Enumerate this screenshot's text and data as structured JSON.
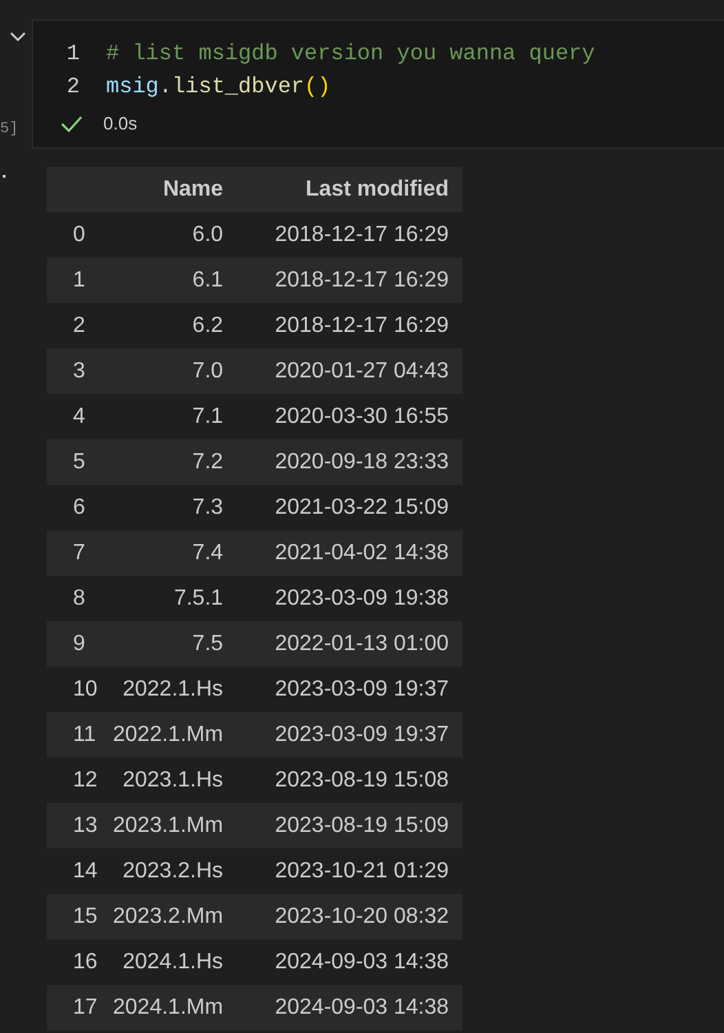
{
  "cell": {
    "execution_count": "5]",
    "collapsed": false,
    "lines": [
      {
        "number": "1",
        "tokens": [
          {
            "kind": "comment",
            "text": "# list msigdb version you wanna query"
          }
        ]
      },
      {
        "number": "2",
        "tokens": [
          {
            "kind": "variable",
            "text": "msig"
          },
          {
            "kind": "plain",
            "text": "."
          },
          {
            "kind": "function",
            "text": "list_dbver"
          },
          {
            "kind": "bracket",
            "text": "()"
          }
        ]
      }
    ],
    "status": {
      "success": true,
      "duration": "0.0s"
    }
  },
  "table": {
    "columns": [
      "",
      "Name",
      "Last modified"
    ],
    "rows": [
      [
        "0",
        "6.0",
        "2018-12-17 16:29"
      ],
      [
        "1",
        "6.1",
        "2018-12-17 16:29"
      ],
      [
        "2",
        "6.2",
        "2018-12-17 16:29"
      ],
      [
        "3",
        "7.0",
        "2020-01-27 04:43"
      ],
      [
        "4",
        "7.1",
        "2020-03-30 16:55"
      ],
      [
        "5",
        "7.2",
        "2020-09-18 23:33"
      ],
      [
        "6",
        "7.3",
        "2021-03-22 15:09"
      ],
      [
        "7",
        "7.4",
        "2021-04-02 14:38"
      ],
      [
        "8",
        "7.5.1",
        "2023-03-09 19:38"
      ],
      [
        "9",
        "7.5",
        "2022-01-13 01:00"
      ],
      [
        "10",
        "2022.1.Hs",
        "2023-03-09 19:37"
      ],
      [
        "11",
        "2022.1.Mm",
        "2023-03-09 19:37"
      ],
      [
        "12",
        "2023.1.Hs",
        "2023-08-19 15:08"
      ],
      [
        "13",
        "2023.1.Mm",
        "2023-08-19 15:09"
      ],
      [
        "14",
        "2023.2.Hs",
        "2023-10-21 01:29"
      ],
      [
        "15",
        "2023.2.Mm",
        "2023-10-20 08:32"
      ],
      [
        "16",
        "2024.1.Hs",
        "2024-09-03 14:38"
      ],
      [
        "17",
        "2024.1.Mm",
        "2024-09-03 14:38"
      ]
    ]
  }
}
